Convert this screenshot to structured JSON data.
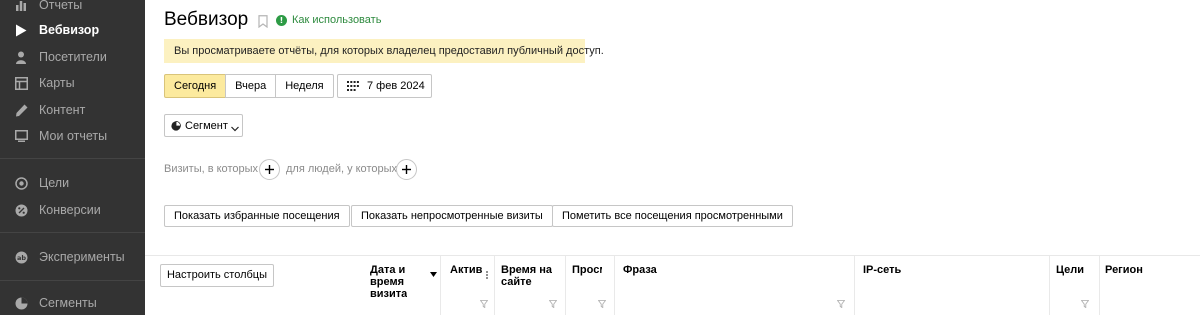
{
  "sidebar": {
    "items": [
      {
        "label": "Отчеты",
        "icon": "bar-chart-icon",
        "active": false
      },
      {
        "label": "Вебвизор",
        "icon": "play-icon",
        "active": true
      },
      {
        "label": "Посетители",
        "icon": "person-icon",
        "active": false
      },
      {
        "label": "Карты",
        "icon": "map-grid-icon",
        "active": false
      },
      {
        "label": "Контент",
        "icon": "pencil-icon",
        "active": false
      },
      {
        "label": "Мои отчеты",
        "icon": "monitor-icon",
        "active": false
      },
      {
        "label": "Цели",
        "icon": "target-icon",
        "active": false
      },
      {
        "label": "Конверсии",
        "icon": "conversion-icon",
        "active": false
      },
      {
        "label": "Эксперименты",
        "icon": "ab-icon",
        "active": false
      },
      {
        "label": "Сегменты",
        "icon": "segment-pie-icon",
        "active": false
      }
    ]
  },
  "header": {
    "title": "Вебвизор",
    "help_label": "Как использовать"
  },
  "notice": "Вы просматриваете отчёты, для которых владелец предоставил публичный доступ.",
  "period": {
    "options": [
      "Сегодня",
      "Вчера",
      "Неделя"
    ],
    "selected": "Сегодня",
    "date_label": "7 фев 2024"
  },
  "segment_label": "Сегмент",
  "filters": {
    "visits_label": "Визиты, в которых",
    "people_label": "для людей, у которых"
  },
  "actions": {
    "show_favorites": "Показать избранные посещения",
    "show_unviewed": "Показать непросмотренные визиты",
    "mark_all_viewed": "Пометить все посещения просмотренными"
  },
  "table": {
    "configure_label": "Настроить столбцы",
    "columns": {
      "visit_time": [
        "Дата и",
        "время",
        "визита"
      ],
      "activity": "Актив",
      "time_on_site": [
        "Время на",
        "сайте"
      ],
      "views": "Просм",
      "phrase": "Фраза",
      "ip_network": "IP-сеть",
      "goals": "Цели",
      "region": "Регион"
    }
  },
  "colors": {
    "sidebar_bg": "#333333",
    "sidebar_text": "#a9a9a9",
    "active_period_bg": "#fcea9e",
    "notice_bg": "#fcf1c1",
    "help_green": "#2d9b45"
  }
}
